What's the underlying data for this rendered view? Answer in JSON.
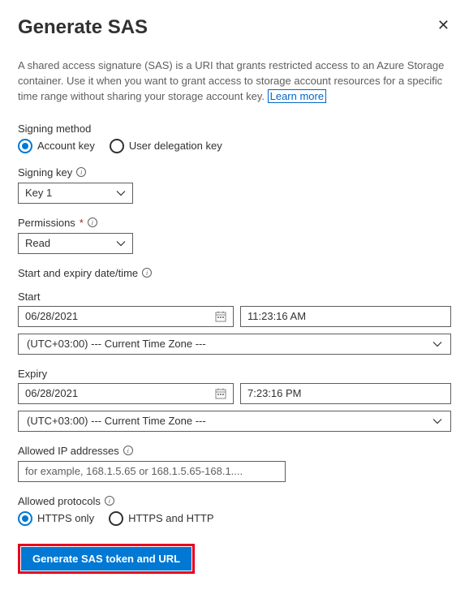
{
  "header": {
    "title": "Generate SAS"
  },
  "description": {
    "text": "A shared access signature (SAS) is a URI that grants restricted access to an Azure Storage container. Use it when you want to grant access to storage account resources for a specific time range without sharing your storage account key.",
    "learn_more": "Learn more"
  },
  "signing_method": {
    "label": "Signing method",
    "options": {
      "account_key": "Account key",
      "user_delegation": "User delegation key"
    }
  },
  "signing_key": {
    "label": "Signing key",
    "value": "Key 1"
  },
  "permissions": {
    "label": "Permissions",
    "value": "Read"
  },
  "datetime_section": {
    "header": "Start and expiry date/time",
    "start_label": "Start",
    "start_date": "06/28/2021",
    "start_time": "11:23:16 AM",
    "start_tz": "(UTC+03:00) --- Current Time Zone ---",
    "expiry_label": "Expiry",
    "expiry_date": "06/28/2021",
    "expiry_time": "7:23:16 PM",
    "expiry_tz": "(UTC+03:00) --- Current Time Zone ---"
  },
  "allowed_ip": {
    "label": "Allowed IP addresses",
    "placeholder": "for example, 168.1.5.65 or 168.1.5.65-168.1...."
  },
  "allowed_protocols": {
    "label": "Allowed protocols",
    "options": {
      "https_only": "HTTPS only",
      "https_and_http": "HTTPS and HTTP"
    }
  },
  "generate_button": {
    "label": "Generate SAS token and URL"
  }
}
